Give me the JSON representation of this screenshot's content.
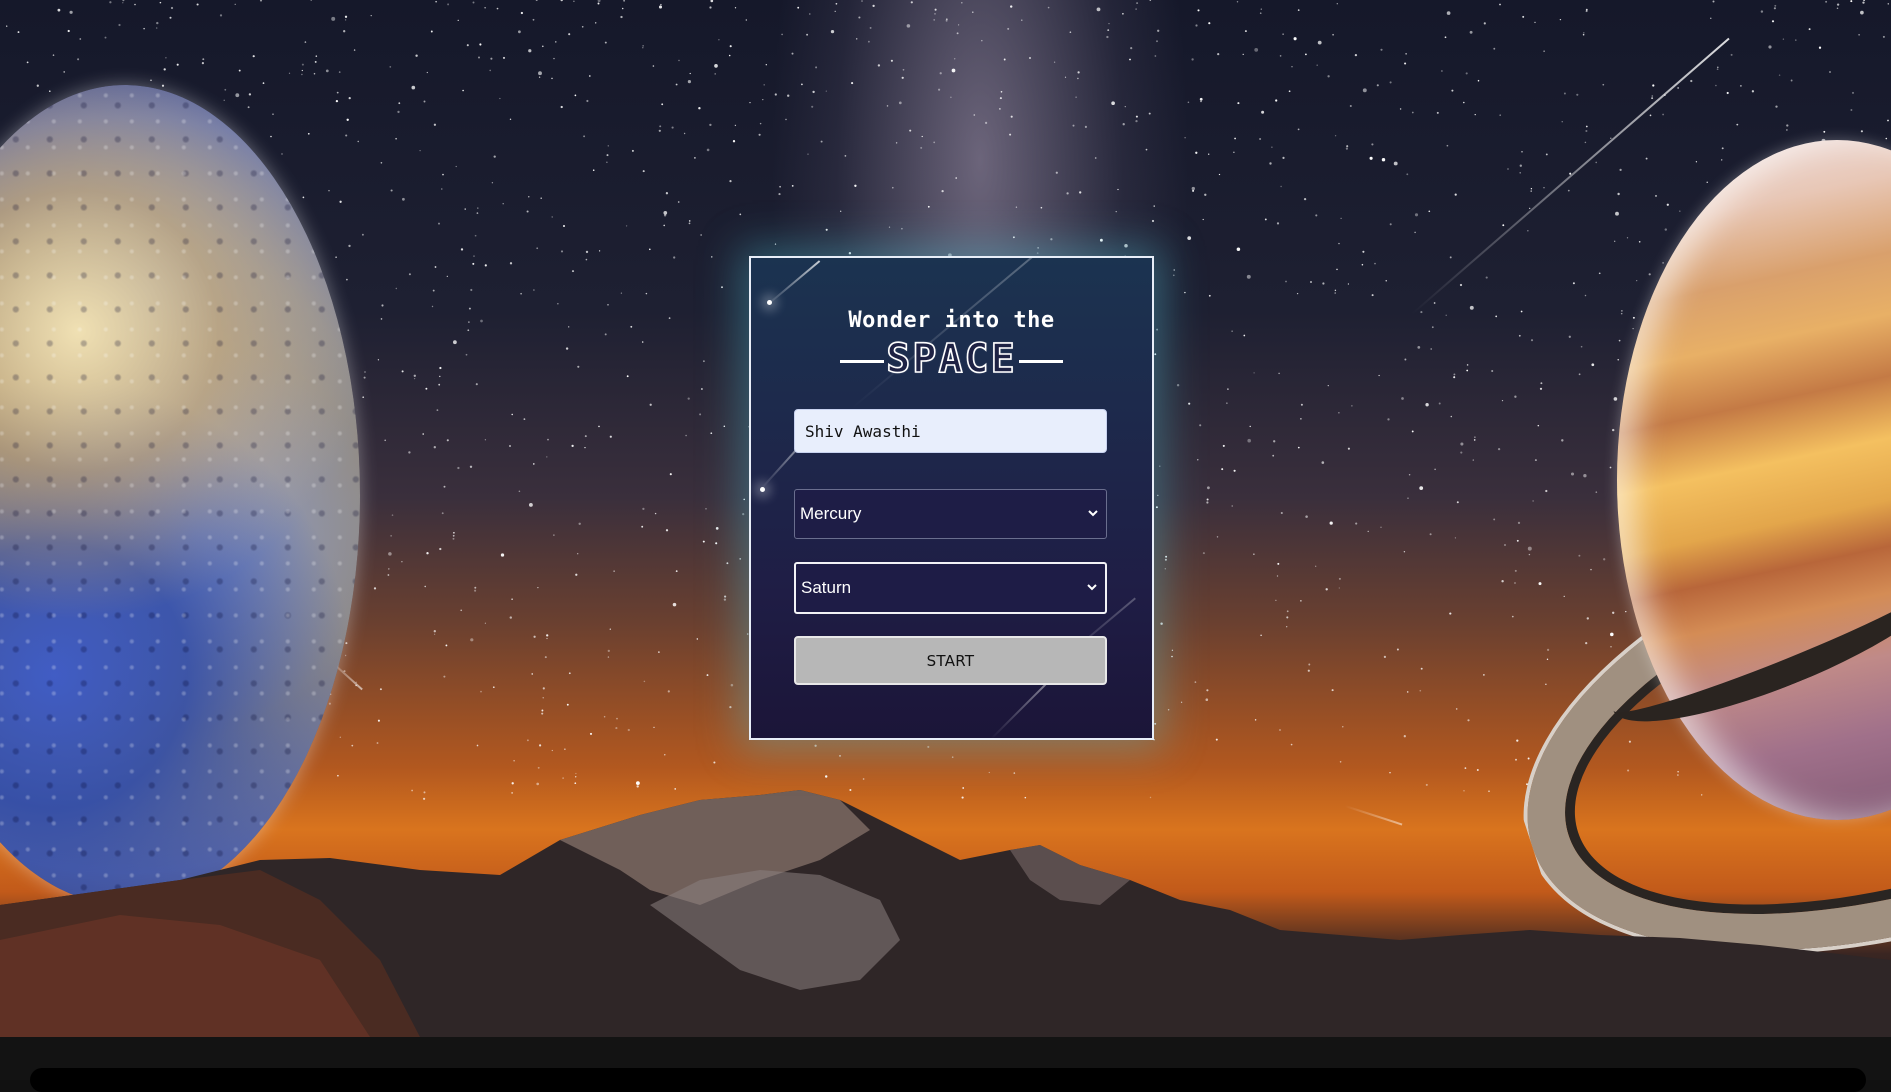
{
  "card": {
    "title": "Wonder into the",
    "heading": "SPACE"
  },
  "form": {
    "name_value": "Shiv Awasthi",
    "origin_planet": "Mercury",
    "destination_planet": "Saturn",
    "start_label": "START"
  },
  "scene": {
    "left_planet": "Mercury",
    "right_planet": "Saturn"
  },
  "icons": {
    "dropdown": "chevron-down-icon"
  },
  "colors": {
    "card_glow": "#50c8dc",
    "input_bg": "#e8eefc",
    "button_bg": "#b7b7b7",
    "sky_horizon": "#d9741e"
  }
}
